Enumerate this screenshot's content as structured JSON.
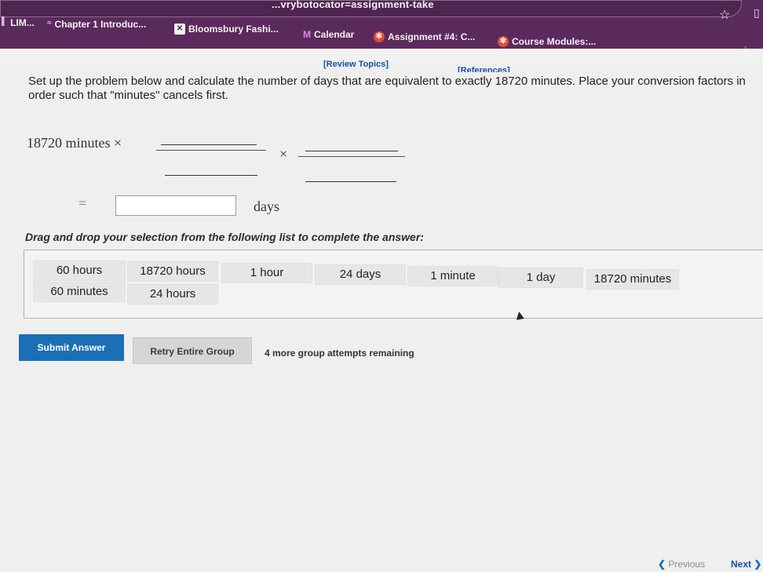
{
  "browser": {
    "url_fragment": "...vrybotocator=assignment-take",
    "bookmarks": [
      {
        "label": "LIM...",
        "icon": "bookmark-icon"
      },
      {
        "label": "Chapter 1 Introduc...",
        "icon": "flag-icon"
      },
      {
        "label": "Bloomsbury Fashi...",
        "icon": "page-icon"
      },
      {
        "label": "Calendar",
        "icon": "m-logo-icon"
      },
      {
        "label": "Assignment #4: C...",
        "icon": "gear-badge-icon"
      },
      {
        "label": "Course Modules:...",
        "icon": "gear-badge-icon"
      }
    ]
  },
  "links": {
    "review_topics": "[Review Topics]",
    "references": "[References]"
  },
  "question": {
    "text": "Set up the problem below and calculate the number of days that are equivalent to exactly 18720 minutes. Place your conversion factors in order such that \"minutes\" cancels first."
  },
  "equation": {
    "start": "18720 minutes ×",
    "times": "×",
    "equals": "=",
    "unit": "days"
  },
  "drag": {
    "title": "Drag and drop your selection from the following list to complete the answer:",
    "options": [
      "60 hours",
      "18720 hours",
      "1 hour",
      "24 days",
      "1 minute",
      "1 day",
      "18720 minutes",
      "60 minutes",
      "24 hours"
    ]
  },
  "actions": {
    "submit": "Submit Answer",
    "retry": "Retry Entire Group",
    "attempts": "4 more group attempts remaining"
  },
  "pager": {
    "previous": "Previous",
    "next": "Next"
  }
}
